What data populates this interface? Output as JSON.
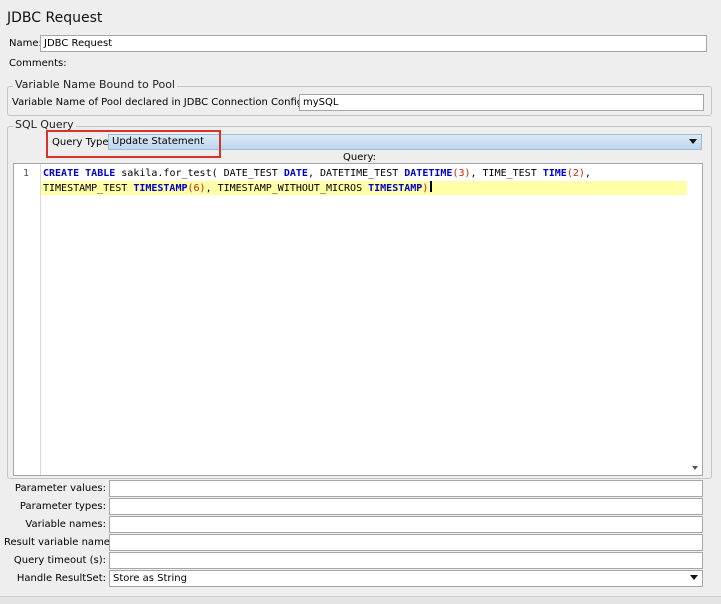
{
  "panel": {
    "title": "JDBC Request",
    "name_label": "Name:",
    "name_value": "JDBC Request",
    "comments_label": "Comments:"
  },
  "pool": {
    "legend": "Variable Name Bound to Pool",
    "label": "Variable Name of Pool declared in JDBC Connection Configuration:",
    "value": "mySQL"
  },
  "sql": {
    "legend": "SQL Query",
    "query_type_label": "Query Type:",
    "query_type_value": "Update Statement",
    "query_label": "Query:",
    "line_number": "1",
    "code": {
      "kw1": "CREATE",
      "kw2": "TABLE",
      "t1": " sakila.for_test( DATE_TEST ",
      "kw3": "DATE",
      "t2": ", DATETIME_TEST ",
      "kw4": "DATETIME",
      "n1": "(3)",
      "t3": ", TIME_TEST ",
      "kw5": "TIME",
      "n2": "(2)",
      "t4": ",",
      "t5": "TIMESTAMP_TEST ",
      "kw6": "TIMESTAMP",
      "n3": "(6)",
      "t6": ", TIMESTAMP_WITHOUT_MICROS ",
      "kw7": "TIMESTAMP",
      "n4": ")"
    }
  },
  "params": {
    "parameter_values_label": "Parameter values:",
    "parameter_types_label": "Parameter types:",
    "variable_names_label": "Variable names:",
    "result_variable_label": "Result variable name:",
    "query_timeout_label": "Query timeout (s):",
    "handle_resultset_label": "Handle ResultSet:",
    "handle_resultset_value": "Store as String"
  },
  "colors": {
    "keyword": "#0000cc",
    "number": "#cc2200",
    "highlight": "#ffffa8",
    "highlight_box": "#d9322a"
  }
}
